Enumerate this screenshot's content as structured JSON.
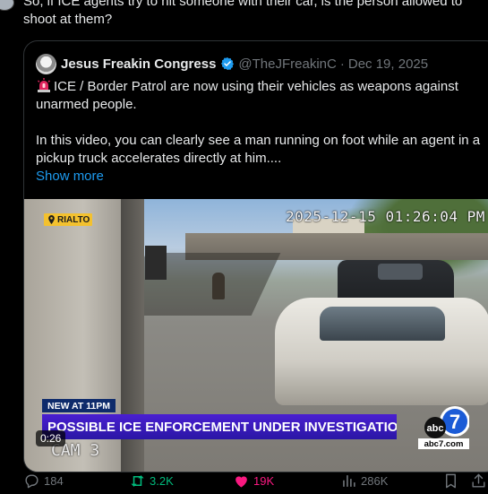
{
  "post": {
    "text": "So, if ICE agents try to hit someone with their car, is the person allowed to shoot at them?"
  },
  "quote": {
    "display_name": "Jesus Freakin Congress",
    "verified_icon": "verified-badge-icon",
    "handle": "@TheJFreakinC",
    "separator": "·",
    "date": "Dec 19, 2025",
    "line1": "ICE / Border Patrol are now using their vehicles as weapons against unarmed people.",
    "line2": "In this video, you can clearly see a man running on foot while an agent in a pickup truck accelerates directly at him....",
    "show_more": "Show more"
  },
  "video": {
    "location_tag": "RIALTO",
    "timestamp": "2025-12-15 01:26:04 PM",
    "news_label": "NEW AT 11PM",
    "headline": "POSSIBLE ICE ENFORCEMENT UNDER INVESTIGATION",
    "station_number": "7",
    "station_brand": "abc",
    "station_site": "abc7.com",
    "camera_label": "CAM 3",
    "duration": "0:26"
  },
  "actions": {
    "replies": "184",
    "reposts": "3.2K",
    "likes": "19K",
    "views": "286K"
  },
  "colors": {
    "background": "#000000",
    "text": "#e7e9ea",
    "muted": "#71767b",
    "link": "#1d9bf0",
    "repost": "#00ba7c",
    "like": "#f91880",
    "verified": "#1d9bf0"
  }
}
